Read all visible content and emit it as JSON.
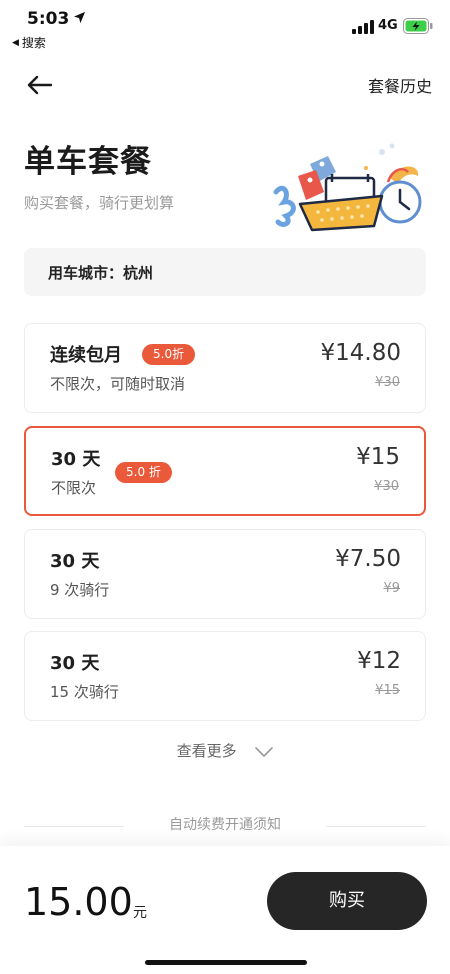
{
  "status_bar": {
    "time": "5:03",
    "back_app": "搜索",
    "network": "4G"
  },
  "nav": {
    "history_label": "套餐历史"
  },
  "header": {
    "title": "单车套餐",
    "subtitle": "购买套餐，骑行更划算"
  },
  "city": {
    "label": "用车城市：杭州"
  },
  "plans": [
    {
      "name": "连续包月",
      "badge": "5.0折",
      "desc": "不限次，可随时取消",
      "price": "¥14.80",
      "original_price": "¥30",
      "selected": false
    },
    {
      "name": "30 天",
      "badge": "5.0 折",
      "desc": "不限次",
      "price": "¥15",
      "original_price": "¥30",
      "selected": true
    },
    {
      "name": "30 天",
      "badge": "",
      "desc": "9 次骑行",
      "price": "¥7.50",
      "original_price": "¥9",
      "selected": false
    },
    {
      "name": "30 天",
      "badge": "",
      "desc": "15 次骑行",
      "price": "¥12",
      "original_price": "¥15",
      "selected": false
    }
  ],
  "see_more": {
    "label": "查看更多"
  },
  "notice": {
    "label": "自动续费开通须知"
  },
  "footer": {
    "amount": "15.00",
    "unit": "元",
    "buy_label": "购买"
  },
  "colors": {
    "accent": "#ea5a3a",
    "button": "#262626",
    "card_border": "#ececec"
  },
  "icons": {
    "back": "arrow-left-icon",
    "location": "location-arrow-icon",
    "signal": "signal-icon",
    "battery": "battery-icon",
    "chevron": "chevron-down-icon"
  }
}
